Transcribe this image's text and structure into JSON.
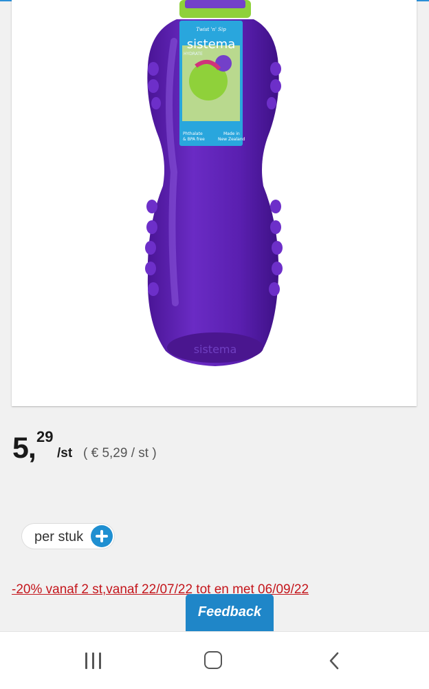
{
  "product": {
    "image_alt": "Sistema Hydrate drinkfles paars",
    "tag": {
      "slogan": "Twist 'n' Sip",
      "brand": "sistema",
      "subbrand": "HYDRATE",
      "left_note_1": "Phthalate",
      "left_note_2": "& BPA free",
      "right_note_1": "Made in",
      "right_note_2": "New Zealand"
    },
    "base_emboss": "sistema"
  },
  "price": {
    "integer": "5,",
    "decimals": "29",
    "unit": "/st",
    "per_unit": "( € 5,29 / st )"
  },
  "unit_selector": {
    "label": "per stuk"
  },
  "promo": {
    "text": "-20% vanaf 2 st,vanaf 22/07/22 tot en met 06/09/22"
  },
  "feedback": {
    "label": "Feedback"
  },
  "colors": {
    "accent": "#1f8fd1",
    "promo": "#c4161c",
    "bottle": "#5a1fa8"
  }
}
